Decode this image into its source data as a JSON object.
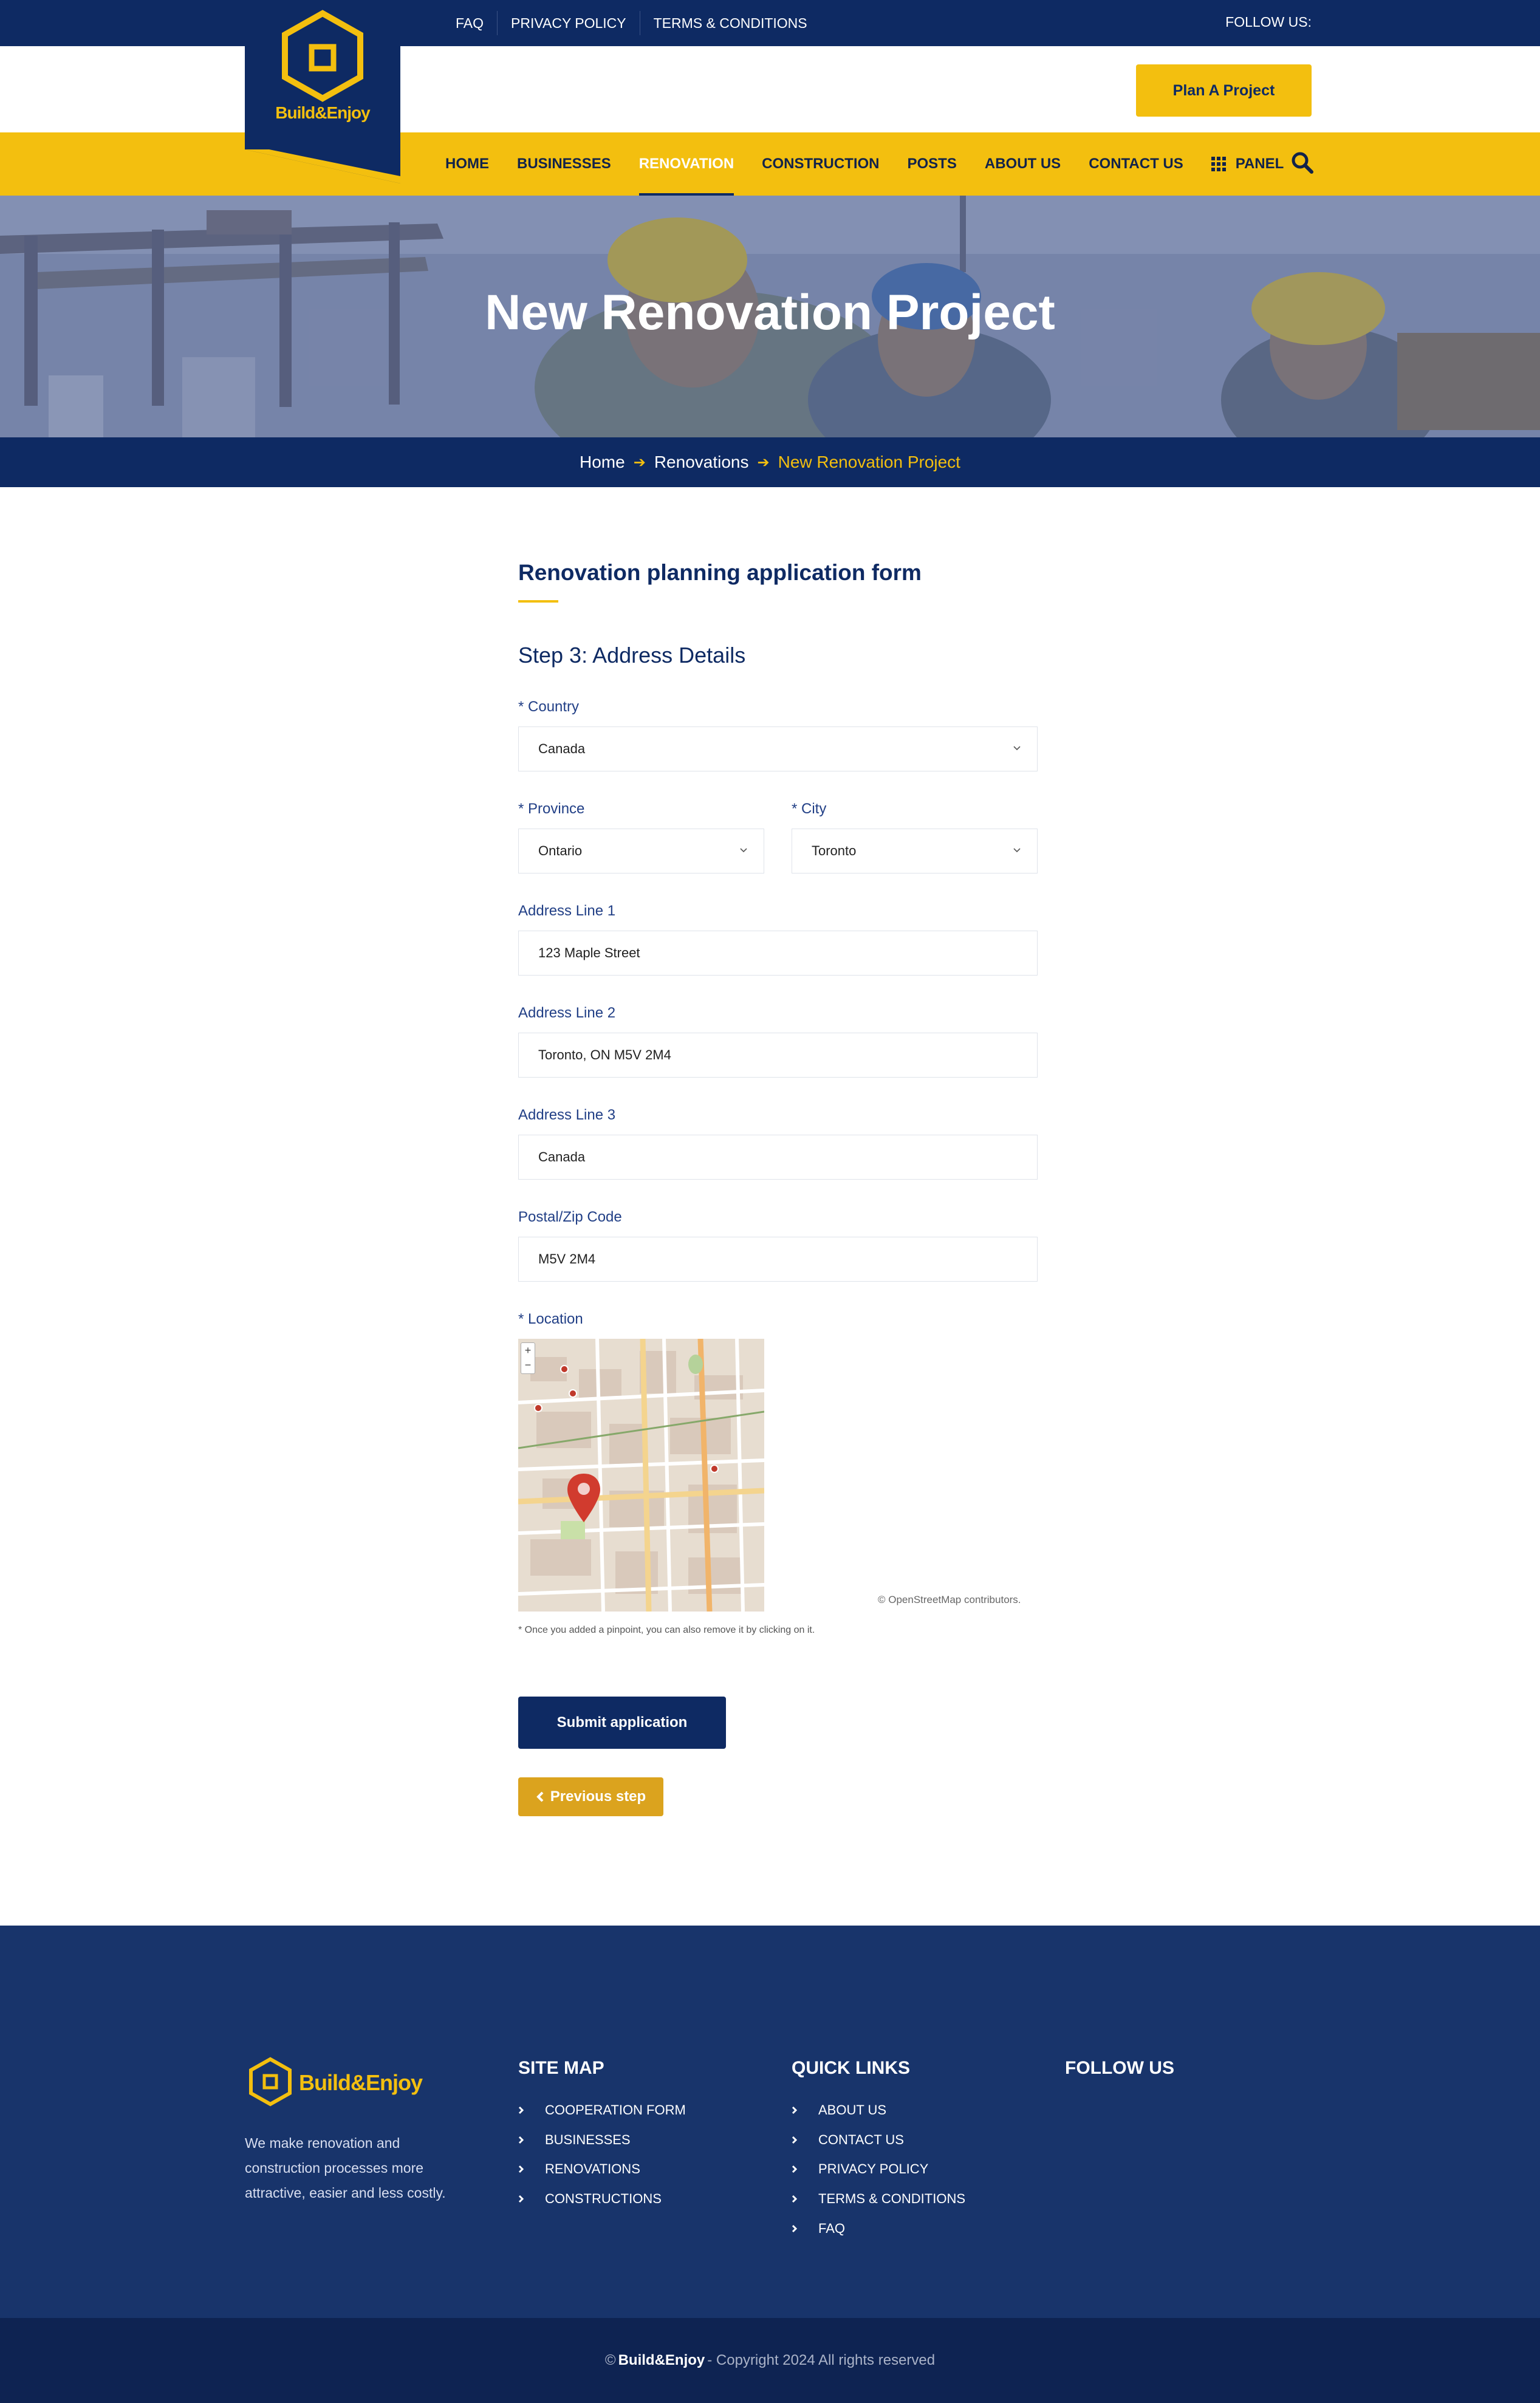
{
  "topbar": {
    "links": [
      "FAQ",
      "PRIVACY POLICY",
      "TERMS & CONDITIONS"
    ],
    "follow_label": "FOLLOW US:"
  },
  "brand": {
    "name": "Build&Enjoy"
  },
  "header": {
    "plan_button": "Plan A Project"
  },
  "nav": {
    "items": [
      "HOME",
      "BUSINESSES",
      "RENOVATION",
      "CONSTRUCTION",
      "POSTS",
      "ABOUT US",
      "CONTACT US"
    ],
    "panel_label": "PANEL",
    "active": "RENOVATION"
  },
  "hero": {
    "title": "New Renovation Project"
  },
  "breadcrumb": {
    "items": [
      "Home",
      "Renovations",
      "New Renovation Project"
    ]
  },
  "form": {
    "title": "Renovation planning application form",
    "step_title": "Step 3: Address Details",
    "country": {
      "label": "* Country",
      "value": "Canada"
    },
    "province": {
      "label": "* Province",
      "value": "Ontario"
    },
    "city": {
      "label": "* City",
      "value": "Toronto"
    },
    "address1": {
      "label": "Address Line 1",
      "value": "123 Maple Street"
    },
    "address2": {
      "label": "Address Line 2",
      "value": "Toronto, ON M5V 2M4"
    },
    "address3": {
      "label": "Address Line 3",
      "value": "Canada"
    },
    "postal": {
      "label": "Postal/Zip Code",
      "value": "M5V 2M4"
    },
    "location": {
      "label": "* Location"
    },
    "map": {
      "zoom_in": "+",
      "zoom_out": "−",
      "credit": "© OpenStreetMap contributors."
    },
    "map_note": "* Once you added a pinpoint, you can also remove it by clicking on it.",
    "submit": "Submit application",
    "previous": "Previous step"
  },
  "footer": {
    "about": "We make renovation and construction processes more attractive, easier and less costly.",
    "sitemap": {
      "heading": "SITE MAP",
      "items": [
        "COOPERATION FORM",
        "BUSINESSES",
        "RENOVATIONS",
        "CONSTRUCTIONS"
      ]
    },
    "quicklinks": {
      "heading": "QUICK LINKS",
      "items": [
        "ABOUT US",
        "CONTACT US",
        "PRIVACY POLICY",
        "TERMS & CONDITIONS",
        "FAQ"
      ]
    },
    "follow": {
      "heading": "FOLLOW US"
    },
    "copyright_prefix": "©",
    "copyright_brand": "Build&Enjoy",
    "copyright_suffix": "- Copyright 2024 All rights reserved"
  },
  "colors": {
    "navy": "#0e2a63",
    "yellow": "#f3bf0f",
    "footer": "#18346b",
    "previous": "#dba31e"
  }
}
